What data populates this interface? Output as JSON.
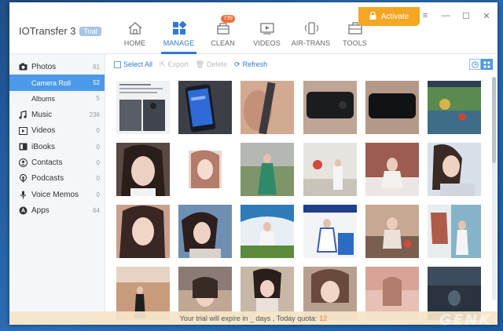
{
  "app": {
    "name": "IOTransfer 3",
    "trial_label": "Trial"
  },
  "nav": [
    {
      "label": "HOME",
      "icon": "home-icon"
    },
    {
      "label": "MANAGE",
      "icon": "manage-icon"
    },
    {
      "label": "CLEAN",
      "icon": "clean-icon",
      "badge": "739"
    },
    {
      "label": "VIDEOS",
      "icon": "videos-icon"
    },
    {
      "label": "AIR-TRANS",
      "icon": "air-trans-icon"
    },
    {
      "label": "TOOLS",
      "icon": "tools-icon"
    }
  ],
  "activate_label": "Activate",
  "colors": {
    "accent": "#2f7ad4",
    "activate": "#f5a623",
    "selected": "#4a9ae8",
    "badge": "#f06d3a"
  },
  "sidebar": {
    "items": [
      {
        "label": "Photos",
        "count": "61",
        "icon": "camera-icon"
      },
      {
        "label": "Camera Roll",
        "count": "52",
        "sub": true,
        "active": true
      },
      {
        "label": "Albums",
        "count": "5",
        "sub": true
      },
      {
        "label": "Music",
        "count": "236",
        "icon": "music-note-icon"
      },
      {
        "label": "Videos",
        "count": "0",
        "icon": "video-icon"
      },
      {
        "label": "iBooks",
        "count": "0",
        "icon": "book-icon"
      },
      {
        "label": "Contacts",
        "count": "0",
        "icon": "contacts-icon"
      },
      {
        "label": "Podcasts",
        "count": "0",
        "icon": "podcast-icon"
      },
      {
        "label": "Voice Memos",
        "count": "0",
        "icon": "microphone-icon"
      },
      {
        "label": "Apps",
        "count": "64",
        "icon": "apps-icon"
      }
    ]
  },
  "toolbar": {
    "select_all": "Select All",
    "export": "Export",
    "delete": "Delete",
    "refresh": "Refresh"
  },
  "trial_notice": {
    "text": "Your trial will expire in _ days , Today quota:",
    "quota": "12"
  },
  "watermark": "GENK"
}
